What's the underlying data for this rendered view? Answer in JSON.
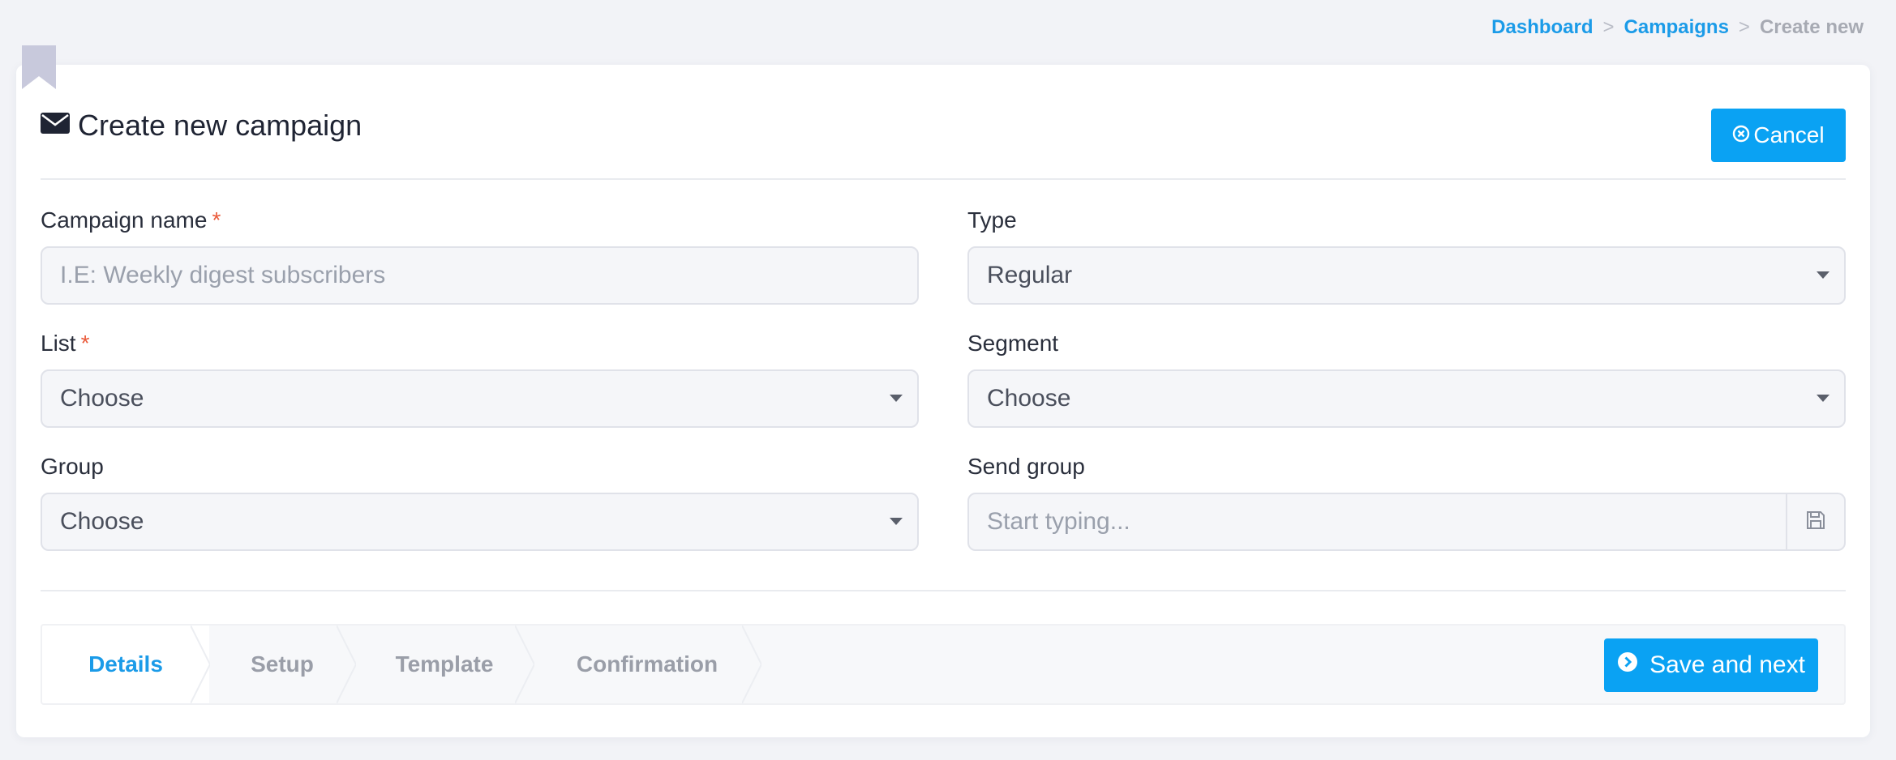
{
  "breadcrumb": {
    "items": [
      "Dashboard",
      "Campaigns",
      "Create new"
    ],
    "separator": ">"
  },
  "header": {
    "title": "Create new campaign",
    "title_icon": "envelope-icon",
    "cancel_label": "Cancel",
    "cancel_icon": "x-circle-icon"
  },
  "form": {
    "campaign_name": {
      "label": "Campaign name",
      "required_mark": "*",
      "placeholder": "I.E: Weekly digest subscribers",
      "value": ""
    },
    "type": {
      "label": "Type",
      "value": "Regular"
    },
    "list": {
      "label": "List",
      "required_mark": "*",
      "value": "Choose"
    },
    "segment": {
      "label": "Segment",
      "value": "Choose"
    },
    "group": {
      "label": "Group",
      "value": "Choose"
    },
    "send_group": {
      "label": "Send group",
      "placeholder": "Start typing...",
      "value": "",
      "addon_icon": "floppy-disk-icon"
    }
  },
  "wizard": {
    "steps": [
      {
        "label": "Details",
        "active": true
      },
      {
        "label": "Setup",
        "active": false
      },
      {
        "label": "Template",
        "active": false
      },
      {
        "label": "Confirmation",
        "active": false
      }
    ],
    "save_next_label": "Save and next",
    "save_next_icon": "chevron-circle-right-icon"
  },
  "colors": {
    "accent": "#0aa2f3",
    "link": "#1b9be8",
    "required": "#ea5a3a",
    "bookmark": "#c8c9dc"
  }
}
